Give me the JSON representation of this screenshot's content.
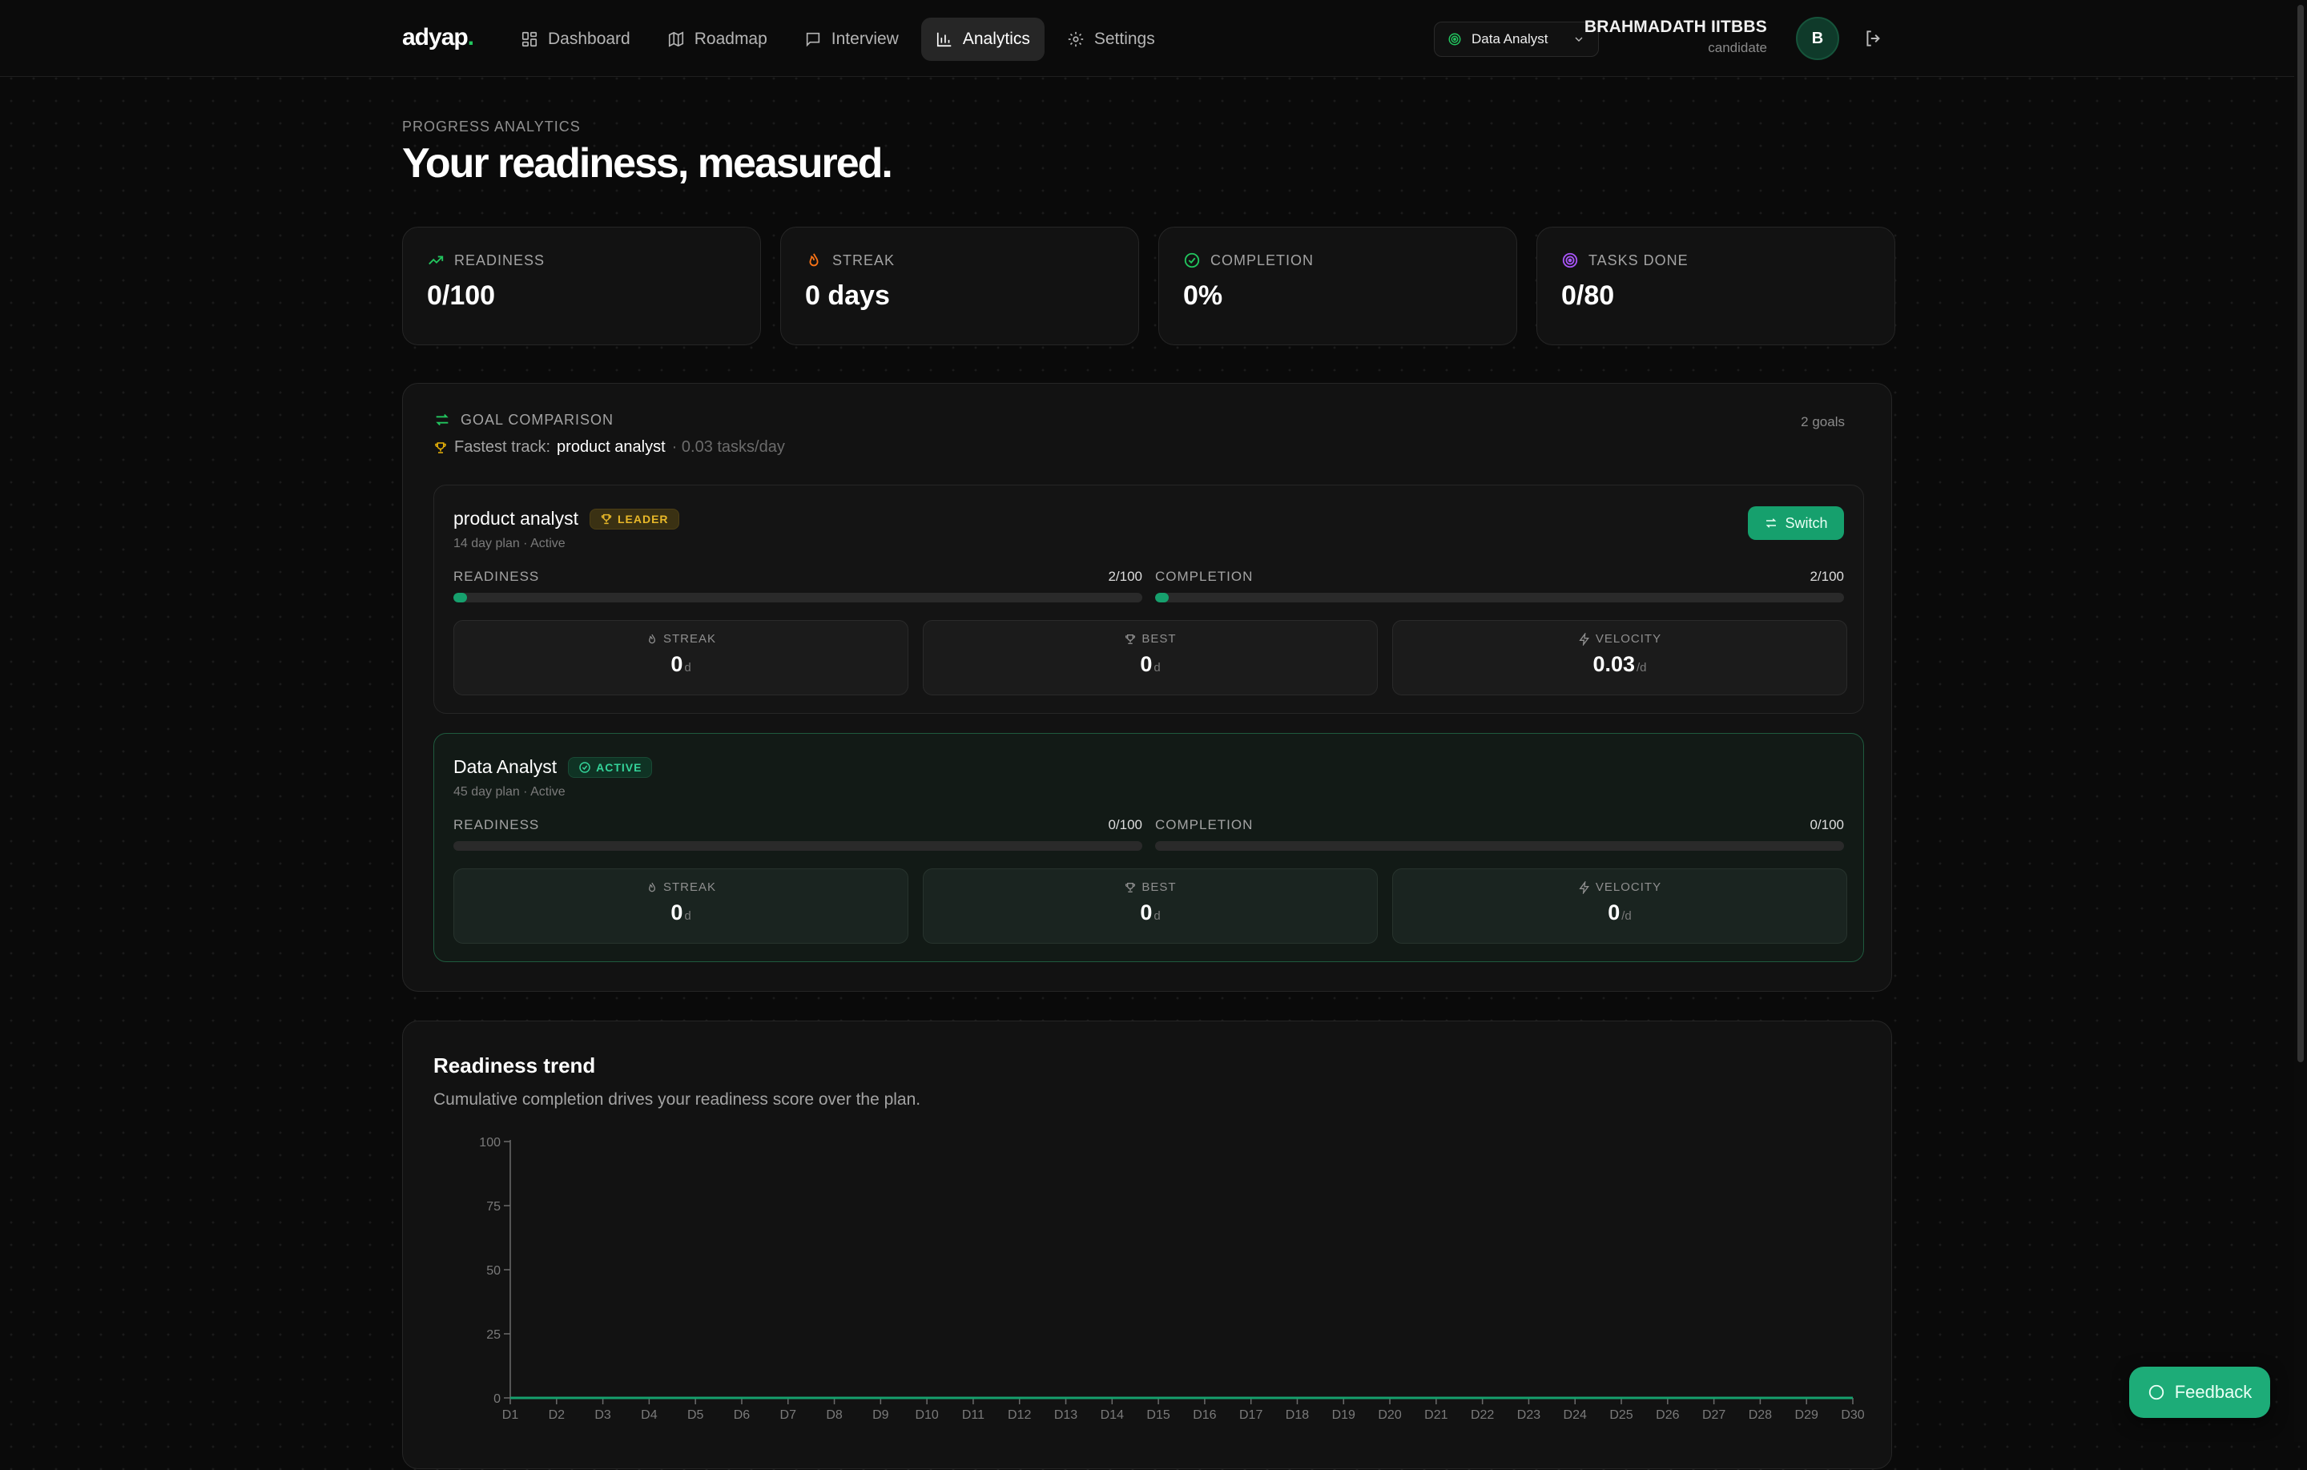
{
  "brand": {
    "name": "adyap",
    "dot": "."
  },
  "nav": {
    "items": [
      {
        "label": "Dashboard",
        "icon": "grid-icon"
      },
      {
        "label": "Roadmap",
        "icon": "map-icon"
      },
      {
        "label": "Interview",
        "icon": "chat-icon"
      },
      {
        "label": "Analytics",
        "icon": "bar-chart-icon",
        "active": true
      },
      {
        "label": "Settings",
        "icon": "gear-icon"
      }
    ]
  },
  "goal_selector": {
    "value": "Data Analyst"
  },
  "user": {
    "name": "BRAHMADATH IITBBS",
    "role": "candidate",
    "initial": "B"
  },
  "header": {
    "eyebrow": "PROGRESS ANALYTICS",
    "title": "Your readiness, measured."
  },
  "stats": [
    {
      "label": "READINESS",
      "value": "0/100",
      "icon": "trend-up-icon",
      "color": "#22c55e"
    },
    {
      "label": "STREAK",
      "value": "0 days",
      "icon": "flame-icon",
      "color": "#f97316"
    },
    {
      "label": "COMPLETION",
      "value": "0%",
      "icon": "check-circle-icon",
      "color": "#22c55e"
    },
    {
      "label": "TASKS DONE",
      "value": "0/80",
      "icon": "target-icon",
      "color": "#a855f7"
    }
  ],
  "comparison": {
    "heading": "GOAL COMPARISON",
    "fastest_prefix": "Fastest track:",
    "fastest_goal": "product analyst",
    "fastest_rate": "· 0.03 tasks/day",
    "count": "2 goals",
    "goals": [
      {
        "name": "product analyst",
        "badge": "LEADER",
        "meta": "14 day plan · Active",
        "action": "Switch",
        "readiness_label": "READINESS",
        "readiness_value": "2/100",
        "readiness_pct": 2,
        "completion_label": "COMPLETION",
        "completion_value": "2/100",
        "completion_pct": 2,
        "tiles": [
          {
            "label": "STREAK",
            "value": "0",
            "unit": "d"
          },
          {
            "label": "BEST",
            "value": "0",
            "unit": "d"
          },
          {
            "label": "VELOCITY",
            "value": "0.03",
            "unit": "/d"
          }
        ]
      },
      {
        "name": "Data Analyst",
        "badge": "ACTIVE",
        "meta": "45 day plan · Active",
        "readiness_label": "READINESS",
        "readiness_value": "0/100",
        "readiness_pct": 0,
        "completion_label": "COMPLETION",
        "completion_value": "0/100",
        "completion_pct": 0,
        "tiles": [
          {
            "label": "STREAK",
            "value": "0",
            "unit": "d"
          },
          {
            "label": "BEST",
            "value": "0",
            "unit": "d"
          },
          {
            "label": "VELOCITY",
            "value": "0",
            "unit": "/d"
          }
        ]
      }
    ]
  },
  "trend": {
    "title": "Readiness trend",
    "subtitle": "Cumulative completion drives your readiness score over the plan."
  },
  "chart_data": {
    "type": "line",
    "title": "Readiness trend",
    "x": [
      "D1",
      "D2",
      "D3",
      "D4",
      "D5",
      "D6",
      "D7",
      "D8",
      "D9",
      "D10",
      "D11",
      "D12",
      "D13",
      "D14",
      "D15",
      "D16",
      "D17",
      "D18",
      "D19",
      "D20",
      "D21",
      "D22",
      "D23",
      "D24",
      "D25",
      "D26",
      "D27",
      "D28",
      "D29",
      "D30"
    ],
    "series": [
      {
        "values": [
          0,
          0,
          0,
          0,
          0,
          0,
          0,
          0,
          0,
          0,
          0,
          0,
          0,
          0,
          0,
          0,
          0,
          0,
          0,
          0,
          0,
          0,
          0,
          0,
          0,
          0,
          0,
          0,
          0,
          0
        ]
      }
    ],
    "yticks": [
      0,
      25,
      50,
      75,
      100
    ],
    "ylim": [
      0,
      100
    ],
    "xlabel": "",
    "ylabel": "",
    "grid": false,
    "line_color": "#16a06d"
  },
  "feedback": {
    "label": "Feedback"
  }
}
